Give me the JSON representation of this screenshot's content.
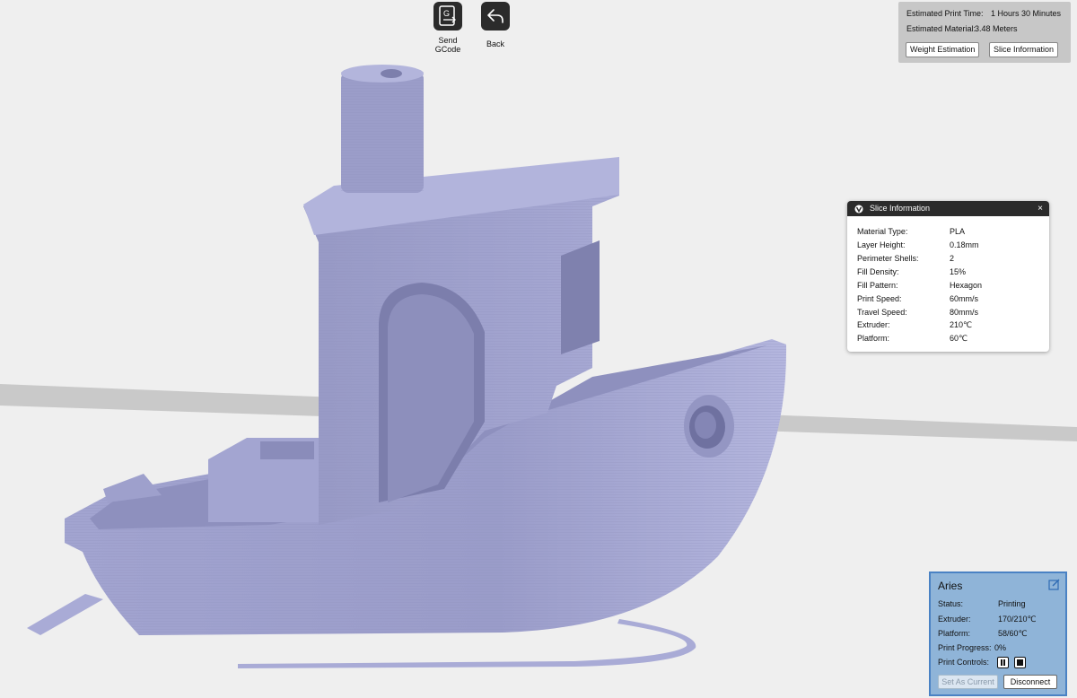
{
  "toolbar": {
    "send_gcode_label": "Send\nGCode",
    "send_gcode_glyph": "G",
    "back_label": "Back"
  },
  "estimates": {
    "print_time_label": "Estimated Print Time:",
    "print_time_value": "1 Hours 30 Minutes",
    "material_label": "Estimated Material:",
    "material_value": "3.48 Meters",
    "weight_button": "Weight Estimation",
    "slice_button": "Slice Information"
  },
  "slice_info": {
    "title": "Slice Information",
    "close": "×",
    "rows": [
      {
        "label": "Material Type:",
        "value": "PLA"
      },
      {
        "label": "Layer Height:",
        "value": "0.18mm"
      },
      {
        "label": "Perimeter Shells:",
        "value": "2"
      },
      {
        "label": "Fill Density:",
        "value": "15%"
      },
      {
        "label": "Fill Pattern:",
        "value": "Hexagon"
      },
      {
        "label": "Print Speed:",
        "value": "60mm/s"
      },
      {
        "label": "Travel Speed:",
        "value": "80mm/s"
      },
      {
        "label": "Extruder:",
        "value": "210℃"
      },
      {
        "label": "Platform:",
        "value": "60℃"
      }
    ]
  },
  "printer": {
    "name": "Aries",
    "status_label": "Status:",
    "status_value": "Printing",
    "extruder_label": "Extruder:",
    "extruder_value": "170/210℃",
    "platform_label": "Platform:",
    "platform_value": "58/60℃",
    "progress_label": "Print Progress:",
    "progress_value": "0%",
    "controls_label": "Print Controls:",
    "set_current": "Set As Current",
    "disconnect": "Disconnect"
  },
  "colors": {
    "model": "#a9abd6",
    "background": "#efefef",
    "bed_edge": "#c9c9c9",
    "panel_dark": "#2b2b2b",
    "printer_panel": "#8fb4d8",
    "printer_border": "#4a82c4"
  }
}
